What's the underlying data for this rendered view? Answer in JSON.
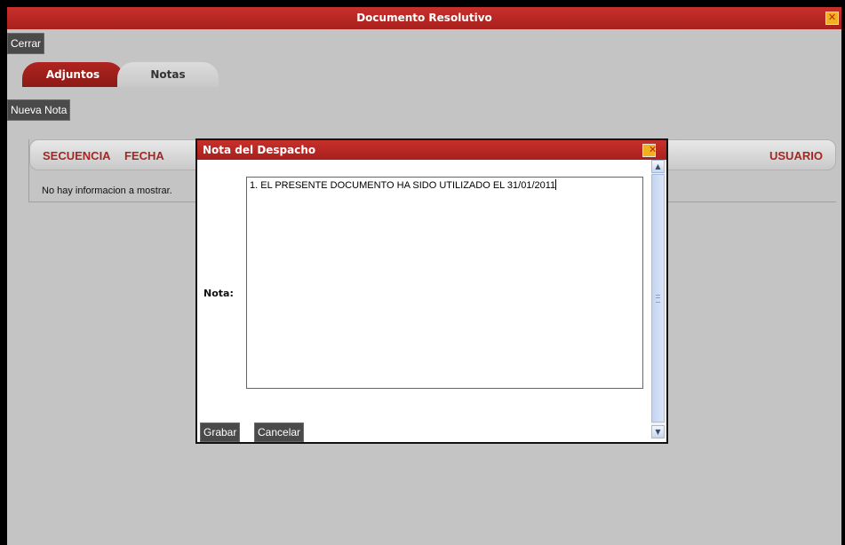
{
  "window": {
    "title": "Documento Resolutivo",
    "close_glyph": "✕"
  },
  "toolbar": {
    "close_label": "Cerrar",
    "new_note_label": "Nueva Nota"
  },
  "tabs": [
    {
      "label": "Adjuntos",
      "active": true
    },
    {
      "label": "Notas",
      "active": false
    }
  ],
  "grid": {
    "columns": [
      "SECUENCIA",
      "FECHA",
      "USUARIO"
    ],
    "empty_message": "No hay informacion a mostrar."
  },
  "dialog": {
    "title": "Nota del Despacho",
    "close_glyph": "✕",
    "field_label": "Nota:",
    "note_value": "1. EL PRESENTE DOCUMENTO HA SIDO UTILIZADO EL 31/01/2011",
    "save_label": "Grabar",
    "cancel_label": "Cancelar",
    "scroll_up_glyph": "▲",
    "scroll_down_glyph": "▼"
  },
  "colors": {
    "title_bar": "#b02420",
    "column_header_text": "#a42722",
    "button_bg": "#4a4a4a",
    "window_bg": "#c4c4c4"
  }
}
